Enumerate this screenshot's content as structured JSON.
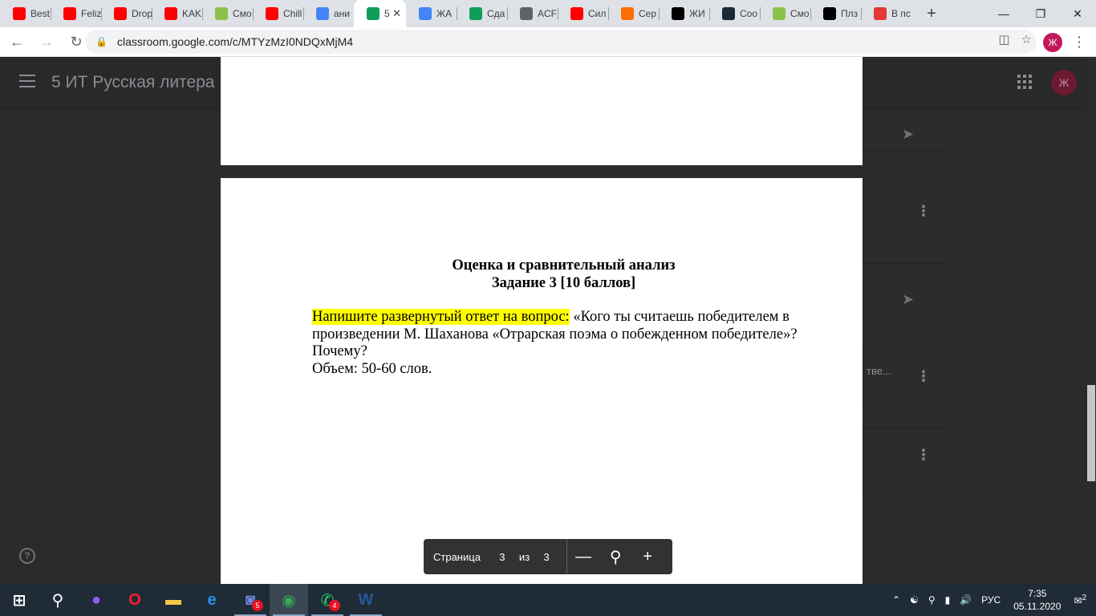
{
  "browser": {
    "tabs": [
      {
        "title": "Best",
        "favicon": "youtube-icon",
        "color": "#ff0000"
      },
      {
        "title": "Feliz",
        "favicon": "youtube-icon",
        "color": "#ff0000"
      },
      {
        "title": "Drop",
        "favicon": "youtube-icon",
        "color": "#ff0000"
      },
      {
        "title": "KAK",
        "favicon": "youtube-icon",
        "color": "#ff0000"
      },
      {
        "title": "Смо",
        "favicon": "web-icon",
        "color": "#8bc34a"
      },
      {
        "title": "Chill",
        "favicon": "youtube-icon",
        "color": "#ff0000"
      },
      {
        "title": "ани",
        "favicon": "google-icon",
        "color": "#4285f4"
      },
      {
        "title": "5",
        "favicon": "classroom-icon",
        "color": "#0f9d58",
        "active": true
      },
      {
        "title": "ЖА",
        "favicon": "docs-icon",
        "color": "#4285f4"
      },
      {
        "title": "Сда",
        "favicon": "classroom-icon",
        "color": "#0f9d58"
      },
      {
        "title": "ACF",
        "favicon": "globe-icon",
        "color": "#5f6368"
      },
      {
        "title": "Сил",
        "favicon": "youtube-icon",
        "color": "#ff0000"
      },
      {
        "title": "Сер",
        "favicon": "web-icon",
        "color": "#ff6d00"
      },
      {
        "title": "ЖИ",
        "favicon": "tiktok-icon",
        "color": "#000000"
      },
      {
        "title": "Соо",
        "favicon": "steam-icon",
        "color": "#1b2838"
      },
      {
        "title": "Смо",
        "favicon": "web-icon",
        "color": "#8bc34a"
      },
      {
        "title": "Плз",
        "favicon": "web-icon",
        "color": "#000000"
      },
      {
        "title": "В пс",
        "favicon": "web-icon",
        "color": "#e53935"
      }
    ],
    "url": "classroom.google.com/c/MTYzMzI0NDQxMjM4",
    "profile_initial": "Ж"
  },
  "classroom": {
    "course_title": "5 ИТ Русская литера",
    "avatar_initial": "Ж",
    "snippet": "тве..."
  },
  "pdf": {
    "heading_line1": "Оценка и сравнительный анализ",
    "heading_line2": "Задание 3 [10 баллов]",
    "highlighted": "Напишите развернутый ответ на вопрос:",
    "body_rest": " «Кого ты считаешь победителем в произведении М. Шаханова «Отрарская поэма о побежденном победителе»? Почему?",
    "volume": "Объем: 50-60 слов.",
    "controls": {
      "page_label": "Страница",
      "current_page": "3",
      "of_label": "из",
      "total_pages": "3"
    }
  },
  "taskbar": {
    "apps": [
      {
        "name": "start-icon"
      },
      {
        "name": "search-icon"
      },
      {
        "name": "alice-icon"
      },
      {
        "name": "opera-icon"
      },
      {
        "name": "folder-icon"
      },
      {
        "name": "edge-icon"
      },
      {
        "name": "discord-icon",
        "badge": "5"
      },
      {
        "name": "chrome-icon",
        "active": true
      },
      {
        "name": "whatsapp-icon",
        "badge": "4"
      },
      {
        "name": "word-icon"
      }
    ],
    "language": "РУС",
    "time": "7:35",
    "date": "05.11.2020",
    "notifications": "2"
  }
}
